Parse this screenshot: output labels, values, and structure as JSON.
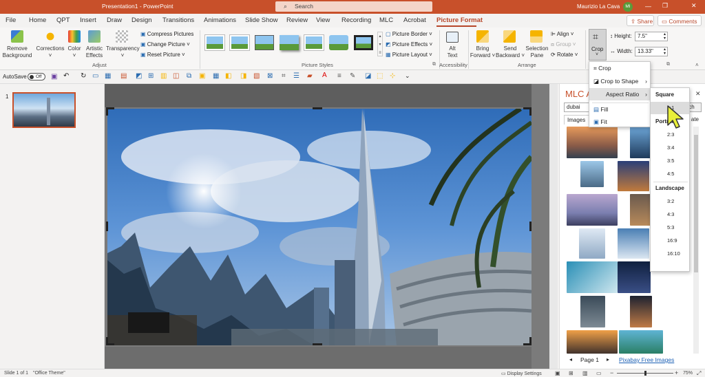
{
  "title": {
    "document": "Presentation1",
    "app": "PowerPoint",
    "separator": " - ",
    "search": "Search",
    "user": "Maurizio La Cava",
    "initials": "MI"
  },
  "window_controls": {
    "minimize": "—",
    "restore": "❐",
    "close": "✕"
  },
  "menu": {
    "tabs": [
      "File",
      "Home",
      "QPT",
      "Insert",
      "Draw",
      "Design",
      "Transitions",
      "Animations",
      "Slide Show",
      "Review",
      "View",
      "Recording",
      "MLC",
      "Acrobat",
      "Picture Format"
    ],
    "share": "Share",
    "comments": "Comments"
  },
  "ribbon": {
    "remove_background": [
      "Remove",
      "Background"
    ],
    "corrections": "Corrections",
    "color": "Color",
    "artistic": [
      "Artistic",
      "Effects"
    ],
    "transparency": "Transparency",
    "compress": "Compress Pictures",
    "change": "Change Picture",
    "reset": "Reset Picture",
    "adjust": "Adjust",
    "border": "Picture Border",
    "effects": "Picture Effects",
    "layout": "Picture Layout",
    "picture_styles": "Picture Styles",
    "alt_text": [
      "Alt",
      "Text"
    ],
    "accessibility": "Accessibility",
    "bring_forward": [
      "Bring",
      "Forward"
    ],
    "send_backward": [
      "Send",
      "Backward"
    ],
    "selection_pane": [
      "Selection",
      "Pane"
    ],
    "align": "Align",
    "group": "Group",
    "rotate": "Rotate",
    "arrange": "Arrange",
    "crop": "Crop",
    "height_label": "Height:",
    "height_value": "7.5\"",
    "width_label": "Width:",
    "width_value": "13.33\""
  },
  "qat": {
    "autosave": "AutoSave",
    "toggle": "Off"
  },
  "slides": {
    "number": "1"
  },
  "crop_menu": {
    "crop": "Crop",
    "crop_to_shape": "Crop to Shape",
    "aspect_ratio": "Aspect Ratio",
    "fill": "Fill",
    "fit": "Fit"
  },
  "aspect_menu": {
    "square": "Square",
    "square_items": [
      "1:1"
    ],
    "portrait": "Portrait",
    "portrait_items": [
      "2:3",
      "3:4",
      "3:5",
      "4:5"
    ],
    "landscape": "Landscape",
    "landscape_items": [
      "3:2",
      "4:3",
      "5:3",
      "16:9",
      "16:10"
    ]
  },
  "pane": {
    "title": "MLC A",
    "search_value": "dubai",
    "search_button": "Search",
    "images_tab": "Images",
    "rotate_tab": "ate",
    "page_label": "Page 1",
    "pixabay": "Pixabay Free Images"
  },
  "status": {
    "slide": "Slide 1 of 1",
    "theme": "\"Office Theme\"",
    "display": "Display Settings",
    "zoom": "75%"
  },
  "colors": {
    "accent": "#c8502a",
    "selected_tab": "#b7472a",
    "link": "#1a5fb4"
  }
}
